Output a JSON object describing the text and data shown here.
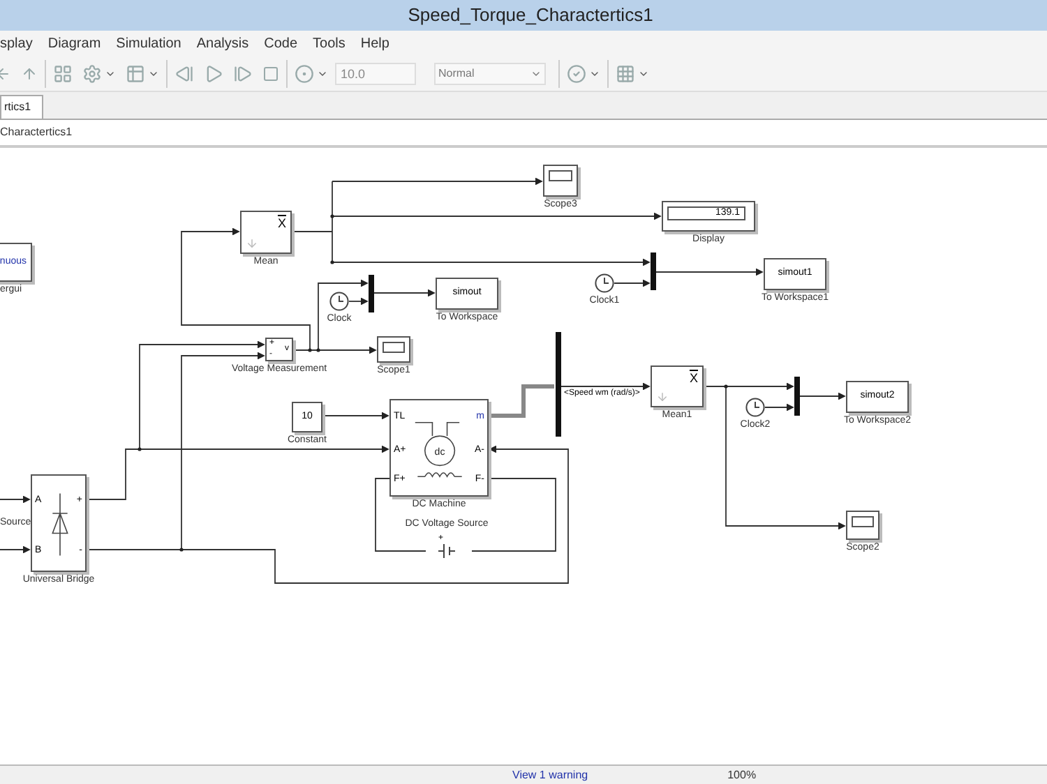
{
  "window": {
    "title": "Speed_Torque_Charactertics1"
  },
  "menu": [
    "splay",
    "Diagram",
    "Simulation",
    "Analysis",
    "Code",
    "Tools",
    "Help"
  ],
  "toolbar": {
    "stop_time": "10.0",
    "mode": "Normal"
  },
  "tabs": [
    {
      "label": "rtics1",
      "selected": true
    }
  ],
  "breadcrumb": "Charactertics1",
  "diagram": {
    "blocks": [
      {
        "kind": "powergui",
        "text": "nuous",
        "label": "ergui"
      },
      {
        "kind": "mean",
        "symbol": "X",
        "label": "Mean"
      },
      {
        "kind": "scope",
        "label": "Scope3"
      },
      {
        "kind": "display",
        "value": "139.1",
        "label": "Display"
      },
      {
        "kind": "clock",
        "label": "Clock1"
      },
      {
        "kind": "workspace",
        "value": "simout1",
        "label": "To Workspace1"
      },
      {
        "kind": "clock",
        "label": "Clock"
      },
      {
        "kind": "workspace",
        "value": "simout",
        "label": "To Workspace"
      },
      {
        "kind": "measurement",
        "ports": [
          "+",
          "-",
          "v"
        ],
        "label": "Voltage Measurement"
      },
      {
        "kind": "scope",
        "label": "Scope1"
      },
      {
        "kind": "constant",
        "value": "10",
        "label": "Constant"
      },
      {
        "kind": "machine",
        "ports": [
          "TL",
          "m",
          "A+",
          "A-",
          "F+",
          "F-"
        ],
        "symbol": "dc",
        "label": "DC Machine"
      },
      {
        "kind": "bridge",
        "ports": [
          "A",
          "B",
          "+",
          "-"
        ],
        "label": "Universal Bridge"
      },
      {
        "kind": "source",
        "label": "Source"
      },
      {
        "kind": "dc_source",
        "sign": "+",
        "label": "DC Voltage Source"
      },
      {
        "kind": "mean",
        "symbol": "X",
        "label": "Mean1"
      },
      {
        "kind": "clock",
        "label": "Clock2"
      },
      {
        "kind": "workspace",
        "value": "simout2",
        "label": "To Workspace2"
      },
      {
        "kind": "scope",
        "label": "Scope2"
      }
    ],
    "signal_labels": [
      "<Speed wm (rad/s)>"
    ]
  },
  "status_bar": {
    "warning": "View 1 warning",
    "zoom": "100%"
  }
}
